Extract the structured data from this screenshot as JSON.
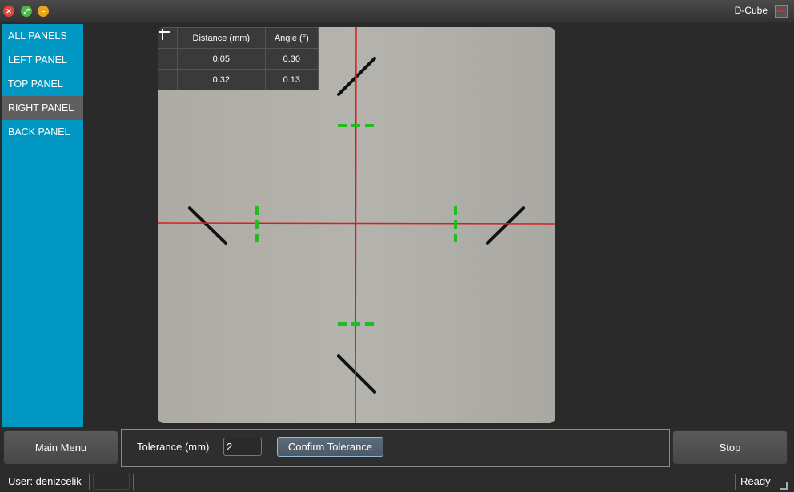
{
  "window": {
    "title": "D-Cube",
    "close_glyph": "✕",
    "max_glyph": "⤢",
    "min_glyph": "–"
  },
  "sidebar": {
    "items": [
      {
        "label": "ALL PANELS"
      },
      {
        "label": "LEFT PANEL"
      },
      {
        "label": "TOP PANEL"
      },
      {
        "label": "RIGHT PANEL",
        "active": true
      },
      {
        "label": "BACK PANEL"
      }
    ]
  },
  "measurements": {
    "headers": [
      "",
      "Distance (mm)",
      "Angle (°)"
    ],
    "rows": [
      {
        "icon": "vertical-bar-icon",
        "distance": "0.05",
        "angle": "0.30"
      },
      {
        "icon": "horizontal-bar-icon",
        "distance": "0.32",
        "angle": "0.13"
      }
    ]
  },
  "controls": {
    "main_menu_label": "Main Menu",
    "tolerance_label": "Tolerance (mm)",
    "tolerance_value": "2",
    "confirm_label": "Confirm Tolerance",
    "stop_label": "Stop"
  },
  "status": {
    "user": "User: denizcelik",
    "state": "Ready"
  },
  "colors": {
    "sidebar_bg": "#0097c2",
    "crosshair": "#d42020",
    "marker_green": "#22bb22"
  }
}
